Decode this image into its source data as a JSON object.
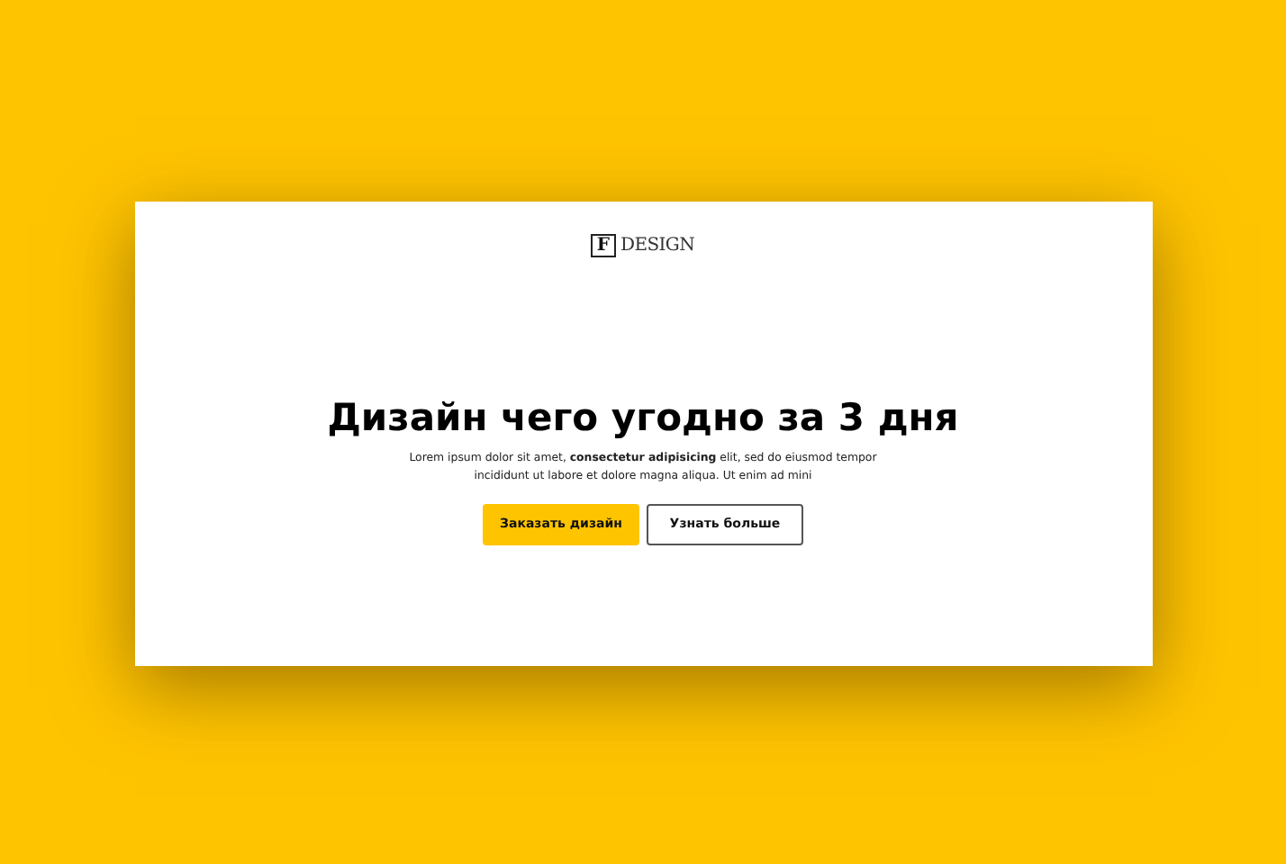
{
  "logo": {
    "mark": "F",
    "name": "DESIGN"
  },
  "hero": {
    "title": "Дизайн чего угодно за 3 дня",
    "text": "Lorem ipsum dolor sit amet, **consectetur adipisicing** elit, sed do eiusmod tempor incididunt ut labore et dolore magna aliqua. Ut enim ad mini",
    "buttons": [
      {
        "label": "Заказать дизайн",
        "kind": "primary"
      },
      {
        "label": "Узнать больше",
        "kind": "outline"
      }
    ]
  }
}
